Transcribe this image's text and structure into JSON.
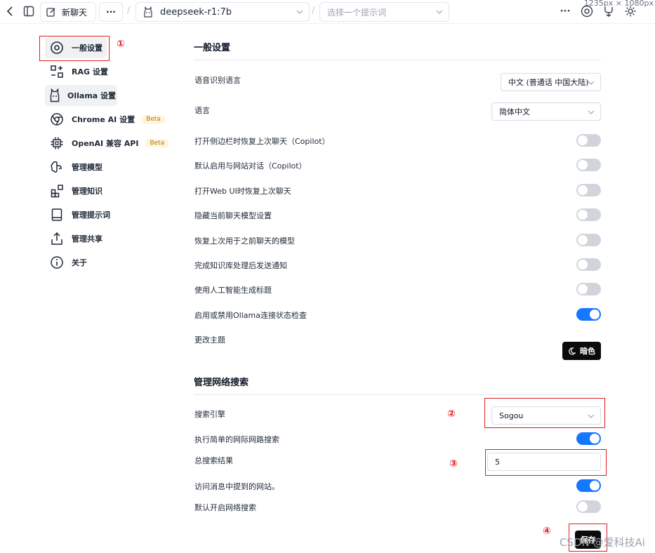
{
  "topbar": {
    "new_chat_label": "新聊天",
    "more_label": "···",
    "model_name": "deepseek-r1:7b",
    "prompt_placeholder": "选择一个提示词",
    "right_more_label": "···",
    "dimension_overlay": "1235px × 1080px"
  },
  "sidebar": {
    "items": [
      {
        "label": "一般设置",
        "icon": "settings-icon",
        "active": true
      },
      {
        "label": "RAG 设置",
        "icon": "rag-icon"
      },
      {
        "label": "Ollama 设置",
        "icon": "ollama-icon",
        "active": true
      },
      {
        "label": "Chrome AI 设置",
        "icon": "chrome-icon",
        "badge": "Beta"
      },
      {
        "label": "OpenAI 兼容 API",
        "icon": "chip-icon",
        "badge": "Beta"
      },
      {
        "label": "管理模型",
        "icon": "brain-icon"
      },
      {
        "label": "管理知识",
        "icon": "blocks-icon"
      },
      {
        "label": "管理提示词",
        "icon": "book-icon"
      },
      {
        "label": "管理共享",
        "icon": "share-icon"
      },
      {
        "label": "关于",
        "icon": "info-icon"
      }
    ]
  },
  "general": {
    "title": "一般设置",
    "speech_lang_label": "语音识别语言",
    "speech_lang_value": "中文 (普通话 中国大陆)",
    "lang_label": "语言",
    "lang_value": "简体中文",
    "toggles": [
      {
        "label": "打开侧边栏时恢复上次聊天（Copilot）",
        "on": false
      },
      {
        "label": "默认启用与网站对话（Copilot）",
        "on": false
      },
      {
        "label": "打开Web UI时恢复上次聊天",
        "on": false
      },
      {
        "label": "隐藏当前聊天模型设置",
        "on": false
      },
      {
        "label": "恢复上次用于之前聊天的模型",
        "on": false
      },
      {
        "label": "完成知识库处理后发送通知",
        "on": false
      },
      {
        "label": "使用人工智能生成标题",
        "on": false
      },
      {
        "label": "启用或禁用Ollama连接状态检查",
        "on": true
      }
    ],
    "theme_label": "更改主题",
    "theme_button": "暗色"
  },
  "web_search": {
    "title": "管理网络搜索",
    "engine_label": "搜索引擎",
    "engine_value": "Sogou",
    "simple_search_label": "执行简单的网际网路搜索",
    "simple_search_on": true,
    "total_results_label": "总搜索结果",
    "total_results_value": "5",
    "visit_sites_label": "访问消息中提到的网站。",
    "visit_sites_on": true,
    "default_on_label": "默认开启网络搜索",
    "default_on_on": false,
    "save_button": "保存"
  },
  "annotations": [
    "①",
    "②",
    "③",
    "④"
  ],
  "watermark": "CSDN @爱科技Ai",
  "colors": {
    "accent": "#1677ff",
    "annotation": "#e11d1d",
    "badge_bg": "#fef6d8",
    "badge_text": "#b7791f"
  }
}
